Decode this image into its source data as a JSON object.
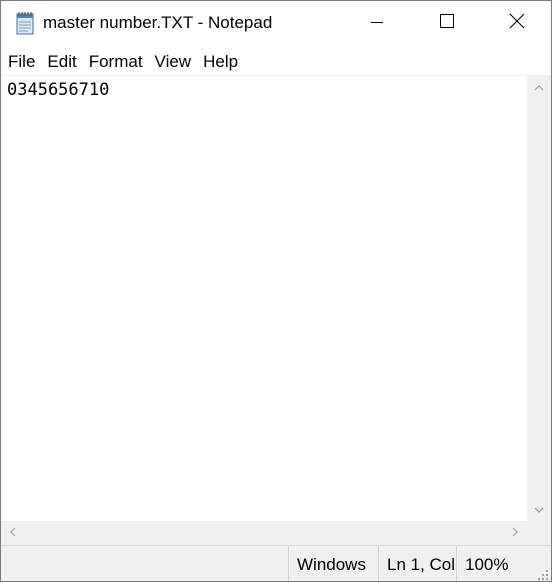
{
  "window": {
    "title": "master number.TXT - Notepad"
  },
  "menu": {
    "items": [
      "File",
      "Edit",
      "Format",
      "View",
      "Help"
    ]
  },
  "editor": {
    "content": "0345656710"
  },
  "status": {
    "encoding": "Windows",
    "position": "Ln 1, Col",
    "zoom": "100%"
  },
  "icons": {
    "app": "notepad-icon",
    "minimize": "minimize-icon",
    "maximize": "maximize-icon",
    "close": "close-icon"
  }
}
